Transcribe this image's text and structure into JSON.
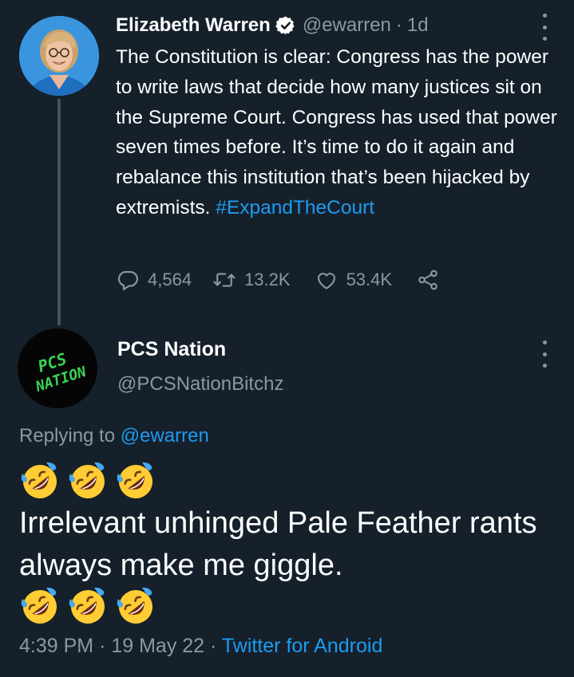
{
  "parent_tweet": {
    "author_name": "Elizabeth Warren",
    "handle": "@ewarren",
    "separator": "·",
    "time_ago": "1d",
    "text": "The Constitution is clear: Congress has the power to write laws that decide how many justices sit on the Supreme Court. Congress has used that power seven times before. It’s time to do it again and rebalance this institution that’s been hijacked by extremists. ",
    "hashtag": "#ExpandTheCourt",
    "stats": {
      "replies": "4,564",
      "retweets": "13.2K",
      "likes": "53.4K"
    }
  },
  "reply_tweet": {
    "author_name": "PCS Nation",
    "handle": "@PCSNationBitchz",
    "avatar_text": [
      "PCS",
      "NATION"
    ],
    "replying_label": "Replying to",
    "replying_to": "@ewarren",
    "emoji": "rolling-on-floor-laughing",
    "text": "Irrelevant unhinged Pale Feather rants always make me giggle.",
    "time": "4:39 PM",
    "separator": "·",
    "date": "19 May 22",
    "source": "Twitter for Android"
  },
  "colors": {
    "background": "#15202b",
    "accent": "#1d9bf0",
    "muted": "#8899a6",
    "avatar_text": "#39d353"
  }
}
